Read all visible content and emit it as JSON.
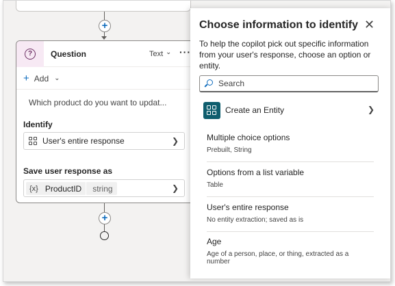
{
  "flow": {
    "question_node": {
      "title": "Question",
      "type_label": "Text",
      "more_label": "···",
      "add_label": "Add",
      "question_text": "Which product do you want to updat...",
      "identify_label": "Identify",
      "identify_value": "User's entire response",
      "save_label": "Save user response as",
      "variable_icon": "{x}",
      "variable_name": "ProductID",
      "variable_type": "string"
    }
  },
  "panel": {
    "title": "Choose information to identify",
    "description": "To help the copilot pick out specific information from your user's response, choose an option or entity.",
    "search_placeholder": "Search",
    "create_entity_label": "Create an Entity",
    "options": [
      {
        "title": "Multiple choice options",
        "subtitle": "Prebuilt, String"
      },
      {
        "title": "Options from a list variable",
        "subtitle": "Table"
      },
      {
        "title": "User's entire response",
        "subtitle": "No entity extraction; saved as is"
      },
      {
        "title": "Age",
        "subtitle": "Age of a person, place, or thing, extracted as a number"
      }
    ]
  },
  "colors": {
    "accent": "#0f6cbd",
    "entity_icon_bg": "#0f5e6e",
    "question_icon_bg": "#f7e9f4",
    "canvas_bg": "#f3f2f1"
  }
}
